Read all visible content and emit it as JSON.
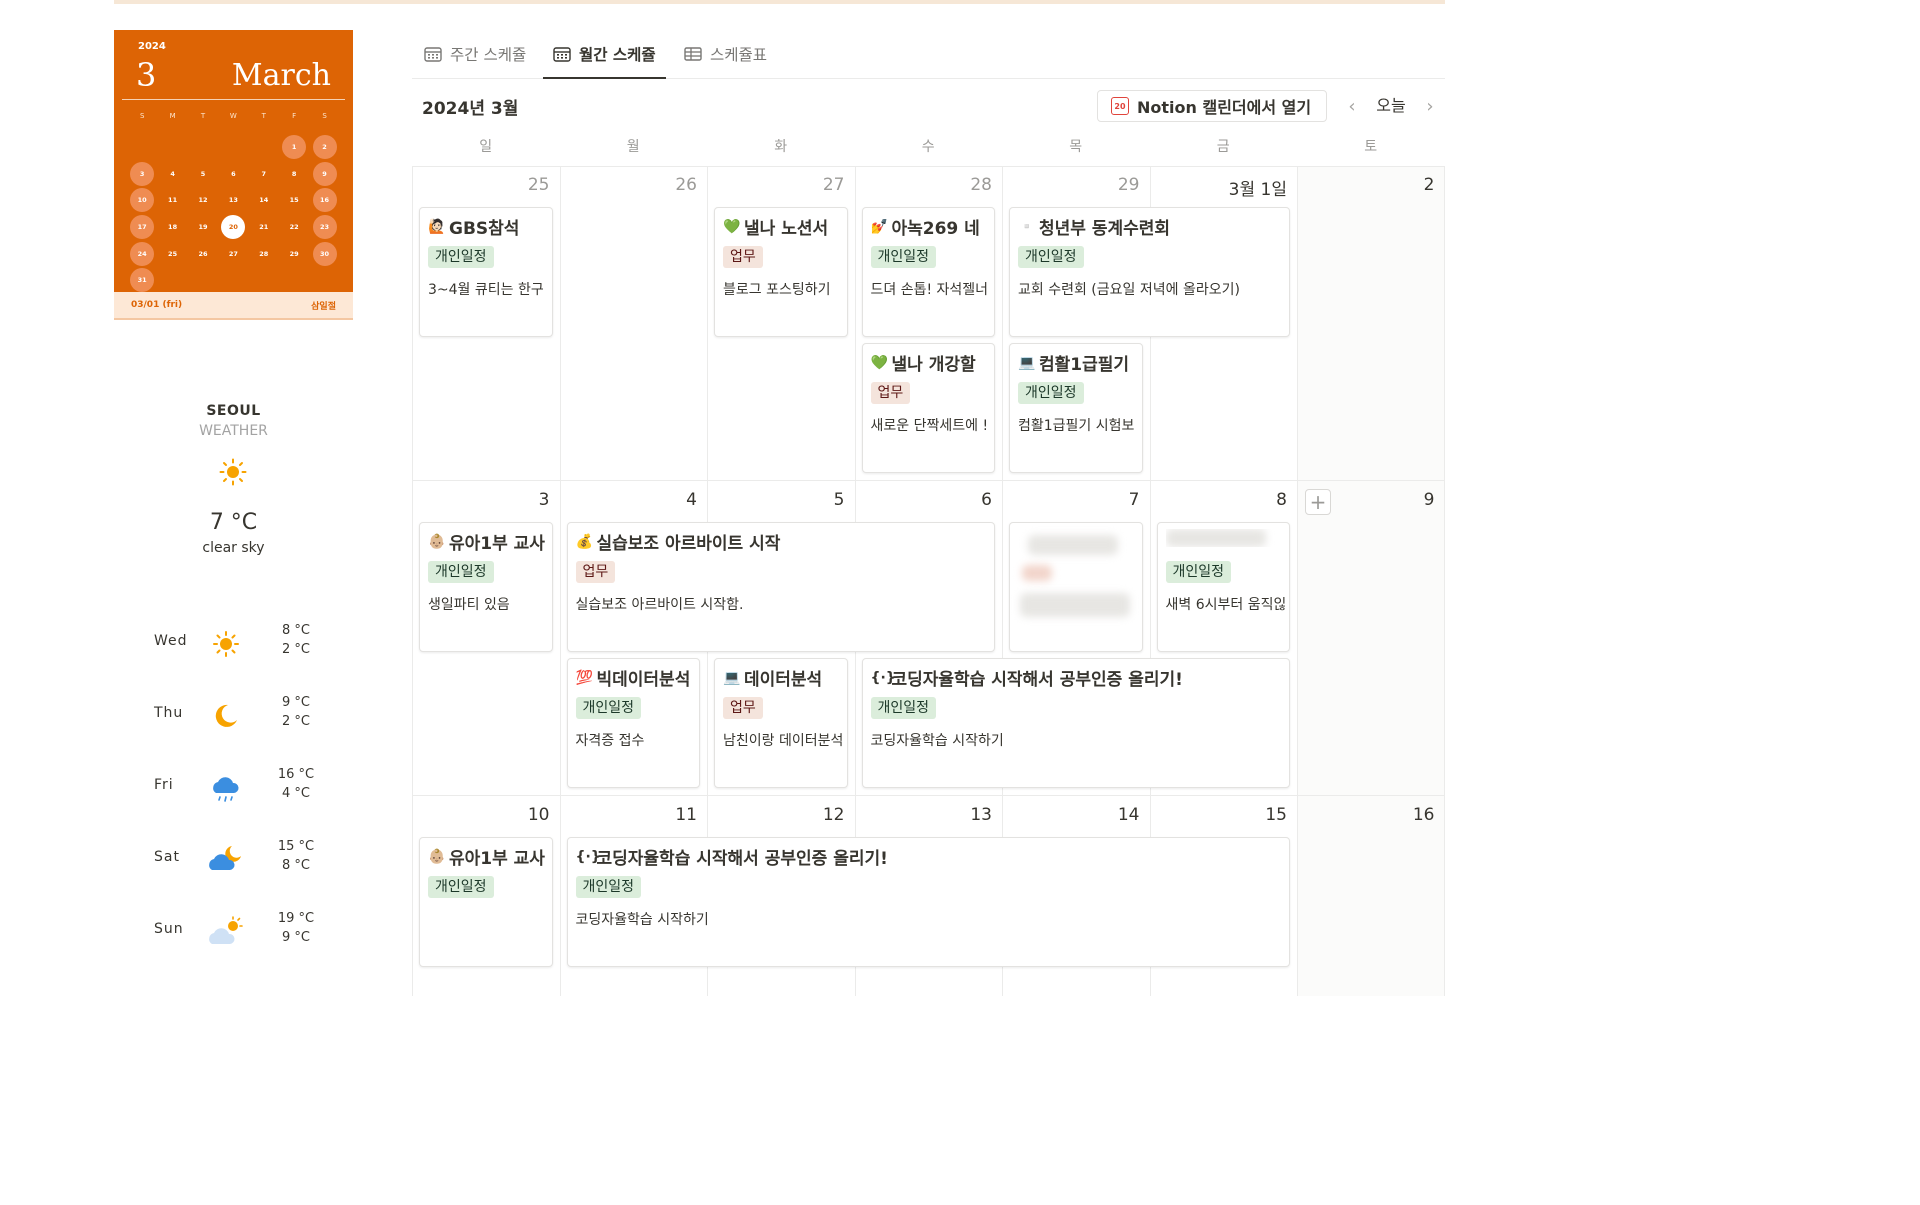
{
  "mini_calendar": {
    "year": "2024",
    "month_number": "3",
    "month_name": "March",
    "weekdays": [
      "S",
      "M",
      "T",
      "W",
      "T",
      "F",
      "S"
    ],
    "leading_blanks": 5,
    "days": [
      "1",
      "2",
      "3",
      "4",
      "5",
      "6",
      "7",
      "8",
      "9",
      "10",
      "11",
      "12",
      "13",
      "14",
      "15",
      "16",
      "17",
      "18",
      "19",
      "20",
      "21",
      "22",
      "23",
      "24",
      "25",
      "26",
      "27",
      "28",
      "29",
      "30",
      "31"
    ],
    "highlighted_days": [
      "1",
      "2",
      "3",
      "9",
      "10",
      "16",
      "17",
      "23",
      "24",
      "30",
      "31"
    ],
    "today": "20",
    "footer_date": "03/01 (fri)",
    "footer_holiday": "삼일절",
    "accent_color": "#dd6405"
  },
  "weather": {
    "city": "SEOUL",
    "label": "WEATHER",
    "current_icon": "sun-icon",
    "current_temp": "7 °C",
    "current_desc": "clear sky",
    "forecast": [
      {
        "day": "Wed",
        "icon": "sun-icon",
        "high": "8 °C",
        "low": "2 °C"
      },
      {
        "day": "Thu",
        "icon": "moon-icon",
        "high": "9 °C",
        "low": "2 °C"
      },
      {
        "day": "Fri",
        "icon": "rain-cloud-icon",
        "high": "16 °C",
        "low": "4 °C"
      },
      {
        "day": "Sat",
        "icon": "cloud-moon-icon",
        "high": "15 °C",
        "low": "8 °C"
      },
      {
        "day": "Sun",
        "icon": "cloud-sun-icon",
        "high": "19 °C",
        "low": "9 °C"
      }
    ]
  },
  "tabs": [
    {
      "label": "주간 스케쥴",
      "icon": "calendar-icon",
      "active": false
    },
    {
      "label": "월간 스케쥴",
      "icon": "calendar-icon",
      "active": true
    },
    {
      "label": "스케쥴표",
      "icon": "table-icon",
      "active": false
    }
  ],
  "calendar": {
    "month_title": "2024년 3월",
    "open_button": "Notion 캘린더에서 열기",
    "open_icon_day": "20",
    "today_button": "오늘",
    "weekdays": [
      "일",
      "월",
      "화",
      "수",
      "목",
      "금",
      "토"
    ],
    "weeks": [
      [
        "25",
        "26",
        "27",
        "28",
        "29",
        "3월 1일",
        "2"
      ],
      [
        "3",
        "4",
        "5",
        "6",
        "7",
        "8",
        "9"
      ],
      [
        "10",
        "11",
        "12",
        "13",
        "14",
        "15",
        "16"
      ]
    ],
    "events": [
      {
        "week": 0,
        "col": 0,
        "span": 1,
        "slot": 0,
        "emoji": "🙋🏻",
        "title": "GBS참석",
        "tag": "개인일정",
        "tag_type": "personal",
        "desc": "3~4월 큐티는 한구"
      },
      {
        "week": 0,
        "col": 2,
        "span": 1,
        "slot": 0,
        "emoji": "💚",
        "title": "낼나 노션서",
        "tag": "업무",
        "tag_type": "work",
        "desc": "블로그 포스팅하기"
      },
      {
        "week": 0,
        "col": 3,
        "span": 1,
        "slot": 0,
        "emoji": "💅",
        "title": "아녹269 네",
        "tag": "개인일정",
        "tag_type": "personal",
        "desc": "드뎌 손톱! 자석젤너"
      },
      {
        "week": 0,
        "col": 4,
        "span": 2,
        "slot": 0,
        "emoji": "▫️",
        "title": "청년부 동계수련회",
        "tag": "개인일정",
        "tag_type": "personal",
        "desc": "교회 수련회 (금요일 저녁에 올라오기)"
      },
      {
        "week": 0,
        "col": 3,
        "span": 1,
        "slot": 1,
        "emoji": "💚",
        "title": "낼나 개강할",
        "tag": "업무",
        "tag_type": "work",
        "desc": "새로운 단짝세트에 !"
      },
      {
        "week": 0,
        "col": 4,
        "span": 1,
        "slot": 1,
        "emoji": "💻",
        "title": "컴활1급필기",
        "tag": "개인일정",
        "tag_type": "personal",
        "desc": "컴활1급필기 시험보"
      },
      {
        "week": 1,
        "col": 0,
        "span": 1,
        "slot": 0,
        "emoji": "👶🏼",
        "title": "유아1부 교사",
        "tag": "개인일정",
        "tag_type": "personal",
        "desc": "생일파티 있음"
      },
      {
        "week": 1,
        "col": 1,
        "span": 3,
        "slot": 0,
        "emoji": "💰",
        "title": "실습보조 아르바이트 시작",
        "tag": "업무",
        "tag_type": "work",
        "desc": "실습보조 아르바이트 시작함."
      },
      {
        "week": 1,
        "col": 4,
        "span": 1,
        "slot": 0,
        "emoji": "",
        "title": "",
        "tag": "",
        "tag_type": "blurred",
        "desc": ""
      },
      {
        "week": 1,
        "col": 5,
        "span": 1,
        "slot": 0,
        "emoji": "",
        "title": "",
        "tag": "개인일정",
        "tag_type": "personal",
        "desc": "새벽 6시부터 움직읺"
      },
      {
        "week": 1,
        "col": 1,
        "span": 1,
        "slot": 1,
        "emoji": "💯",
        "title": "빅데이터분석",
        "tag": "개인일정",
        "tag_type": "personal",
        "desc": "자격증 접수"
      },
      {
        "week": 1,
        "col": 2,
        "span": 1,
        "slot": 1,
        "emoji": "💻",
        "title": "데이터분석",
        "tag": "업무",
        "tag_type": "work",
        "desc": "남친이랑 데이터분석"
      },
      {
        "week": 1,
        "col": 3,
        "span": 3,
        "slot": 1,
        "emoji": "{·}",
        "title": "코딩자율학습 시작해서 공부인증 올리기!",
        "tag": "개인일정",
        "tag_type": "personal",
        "desc": "코딩자율학습 시작하기"
      },
      {
        "week": 2,
        "col": 0,
        "span": 1,
        "slot": 0,
        "emoji": "👶🏼",
        "title": "유아1부 교사",
        "tag": "개인일정",
        "tag_type": "personal",
        "desc": ""
      },
      {
        "week": 2,
        "col": 1,
        "span": 5,
        "slot": 0,
        "emoji": "{·}",
        "title": "코딩자율학습 시작해서 공부인증 올리기!",
        "tag": "개인일정",
        "tag_type": "personal",
        "desc": "코딩자율학습 시작하기"
      }
    ]
  }
}
